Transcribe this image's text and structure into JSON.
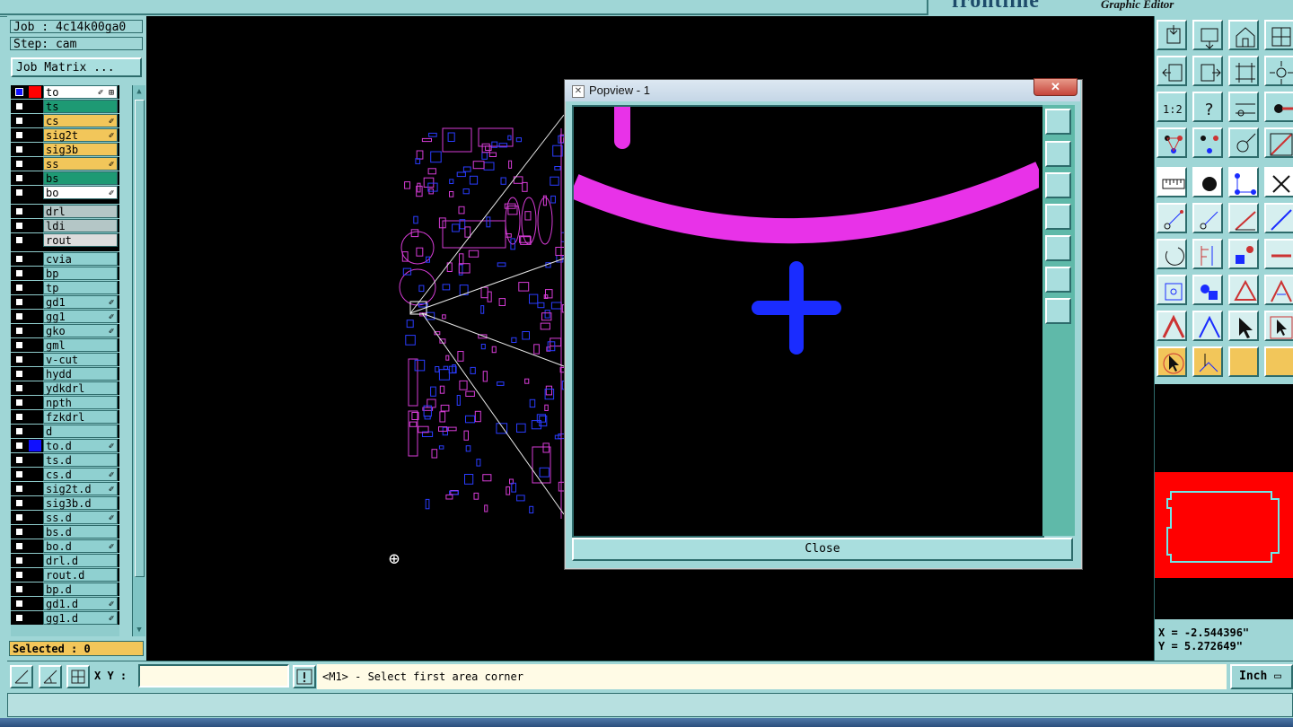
{
  "app": {
    "title": "Graphic Editor",
    "brand_fragment": "frontline"
  },
  "job": {
    "job_line": "Job : 4c14k00ga0",
    "step_line": "Step: cam",
    "matrix_button": "Job Matrix ..."
  },
  "layers": [
    {
      "name": "to",
      "color": "#ffffff",
      "swatch": "#ff0000",
      "mark": "✐ ⊞",
      "selected": true
    },
    {
      "name": "ts",
      "color": "#1e9a74",
      "swatch": "#000000",
      "mark": ""
    },
    {
      "name": "cs",
      "color": "#f2c65a",
      "swatch": "#000000",
      "mark": "✐"
    },
    {
      "name": "sig2t",
      "color": "#f2c65a",
      "swatch": "#000000",
      "mark": "✐"
    },
    {
      "name": "sig3b",
      "color": "#f2c65a",
      "swatch": "#000000",
      "mark": ""
    },
    {
      "name": "ss",
      "color": "#f2c65a",
      "swatch": "#000000",
      "mark": "✐"
    },
    {
      "name": "bs",
      "color": "#1e9a74",
      "swatch": "#000000",
      "mark": ""
    },
    {
      "name": "bo",
      "color": "#ffffff",
      "swatch": "#000000",
      "mark": "✐"
    },
    {
      "sep": true
    },
    {
      "name": "drl",
      "color": "#b4c6c6",
      "swatch": "#000000",
      "mark": ""
    },
    {
      "name": "ldi",
      "color": "#b4c6c6",
      "swatch": "#000000",
      "mark": ""
    },
    {
      "name": "rout",
      "color": "#dcdcdc",
      "swatch": "#000000",
      "mark": ""
    },
    {
      "sep": true
    },
    {
      "name": "cvia",
      "color": "#8fd0d0",
      "swatch": "#000000",
      "mark": ""
    },
    {
      "name": "bp",
      "color": "#8fd0d0",
      "swatch": "#000000",
      "mark": ""
    },
    {
      "name": "tp",
      "color": "#8fd0d0",
      "swatch": "#000000",
      "mark": ""
    },
    {
      "name": "gd1",
      "color": "#8fd0d0",
      "swatch": "#000000",
      "mark": "✐"
    },
    {
      "name": "gg1",
      "color": "#8fd0d0",
      "swatch": "#000000",
      "mark": "✐"
    },
    {
      "name": "gko",
      "color": "#8fd0d0",
      "swatch": "#000000",
      "mark": "✐"
    },
    {
      "name": "gml",
      "color": "#8fd0d0",
      "swatch": "#000000",
      "mark": ""
    },
    {
      "name": "v-cut",
      "color": "#8fd0d0",
      "swatch": "#000000",
      "mark": ""
    },
    {
      "name": "hydd",
      "color": "#8fd0d0",
      "swatch": "#000000",
      "mark": ""
    },
    {
      "name": "ydkdrl",
      "color": "#8fd0d0",
      "swatch": "#000000",
      "mark": ""
    },
    {
      "name": "npth",
      "color": "#8fd0d0",
      "swatch": "#000000",
      "mark": ""
    },
    {
      "name": "fzkdrl",
      "color": "#8fd0d0",
      "swatch": "#000000",
      "mark": ""
    },
    {
      "name": "d",
      "color": "#8fd0d0",
      "swatch": "#000000",
      "mark": ""
    },
    {
      "name": "to.d",
      "color": "#8fd0d0",
      "swatch": "#1010ff",
      "mark": "✐"
    },
    {
      "name": "ts.d",
      "color": "#8fd0d0",
      "swatch": "#000000",
      "mark": ""
    },
    {
      "name": "cs.d",
      "color": "#8fd0d0",
      "swatch": "#000000",
      "mark": "✐"
    },
    {
      "name": "sig2t.d",
      "color": "#8fd0d0",
      "swatch": "#000000",
      "mark": "✐"
    },
    {
      "name": "sig3b.d",
      "color": "#8fd0d0",
      "swatch": "#000000",
      "mark": ""
    },
    {
      "name": "ss.d",
      "color": "#8fd0d0",
      "swatch": "#000000",
      "mark": "✐"
    },
    {
      "name": "bs.d",
      "color": "#8fd0d0",
      "swatch": "#000000",
      "mark": ""
    },
    {
      "name": "bo.d",
      "color": "#8fd0d0",
      "swatch": "#000000",
      "mark": "✐"
    },
    {
      "name": "drl.d",
      "color": "#8fd0d0",
      "swatch": "#000000",
      "mark": ""
    },
    {
      "name": "rout.d",
      "color": "#8fd0d0",
      "swatch": "#000000",
      "mark": ""
    },
    {
      "name": "bp.d",
      "color": "#8fd0d0",
      "swatch": "#000000",
      "mark": ""
    },
    {
      "name": "gd1.d",
      "color": "#8fd0d0",
      "swatch": "#000000",
      "mark": "✐"
    },
    {
      "name": "gg1.d",
      "color": "#8fd0d0",
      "swatch": "#000000",
      "mark": "✐"
    }
  ],
  "selection": {
    "label": "Selected : 0"
  },
  "popview": {
    "title": "Popview - 1",
    "close_x": "✕",
    "close_button": "Close",
    "icon_glyph": "✕"
  },
  "coords": {
    "x": "X = -2.544396\"",
    "y": "Y = 5.272649\""
  },
  "command": {
    "xy_label": "X Y :",
    "xy_value": "",
    "prompt": "<M1> - Select first area corner",
    "units": "Inch",
    "units_glyph": "▭"
  },
  "colors": {
    "canvas": "#000000",
    "panel": "#9fd6d6",
    "magenta": "#e832e8",
    "blue": "#1a2cff",
    "accent_red": "#ff0000",
    "highlight": "#f2c65a"
  },
  "icons": {
    "right_toolbar": [
      "zoom-home-icon",
      "zoom-in-icon",
      "home-icon",
      "grid-icon",
      "pan-left-icon",
      "pan-right-icon",
      "fit-icon",
      "stretch-icon",
      "zoom-area-icon",
      "zoom-fit-icon",
      "scale-1-2-icon",
      "help-icon",
      "measure-icon",
      "key-icon",
      "snap-net-icon",
      "snap-net2-icon",
      "point-icon",
      "line-draw-icon",
      "ruler-icon",
      "circle-icon",
      "node-icon",
      "cross-icon",
      "arrow-icon",
      "arrow2-icon",
      "angle-icon",
      "diagonal-icon",
      "arc-icon",
      "text-icon",
      "select-point-icon",
      "dash-icon",
      "box-icon",
      "multi-icon",
      "triangle-icon",
      "triangle2-icon",
      "triangle3-icon",
      "triangle4-icon",
      "pointer-icon",
      "pointer-box-icon",
      "pointer-circle-icon",
      "route-icon"
    ]
  }
}
